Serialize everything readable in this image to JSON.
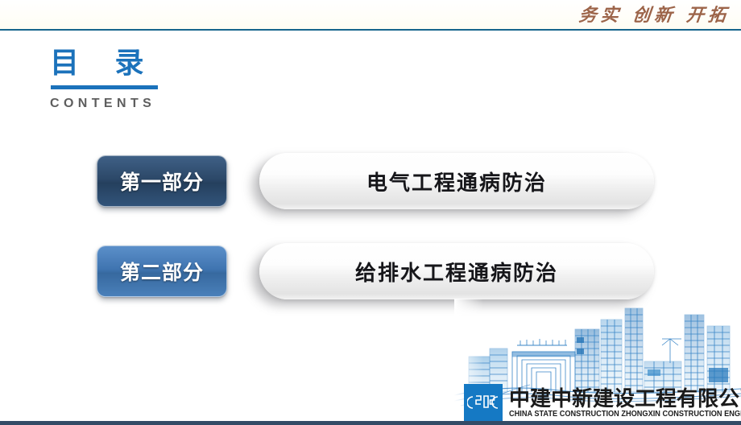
{
  "header": {
    "motto": "务实 创新 开拓",
    "rule_color": "#16648c"
  },
  "heading": {
    "title_cn": "目 录",
    "title_en": "CONTENTS",
    "accent_color": "#1b72bb"
  },
  "contents": {
    "items": [
      {
        "badge": "第一部分",
        "badge_color": "#2c4868",
        "title": "电气工程通病防治"
      },
      {
        "badge": "第二部分",
        "badge_color": "#3f74b0",
        "title": "给排水工程通病防治"
      }
    ]
  },
  "footer": {
    "logo_text": "cSCEc",
    "company_cn": "中建中新建设工程有限公司",
    "company_en": "CHINA STATE CONSTRUCTION ZHONGXIN CONSTRUCTION ENGINEERINBG CO.,LTD",
    "logo_bg": "#1579c4",
    "bar_color": "#334b66"
  },
  "artwork": {
    "skyline_label": "city-skyline-line-art",
    "skyline_color": "#2f7fc4"
  }
}
